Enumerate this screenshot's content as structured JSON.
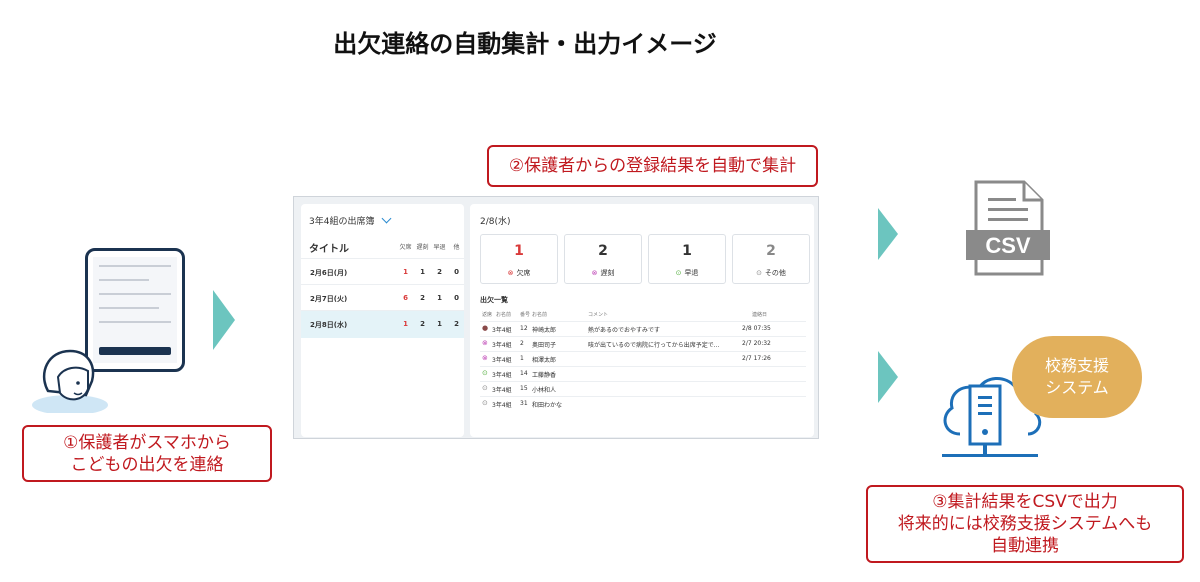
{
  "title": "出欠連絡の自動集計・出力イメージ",
  "step1": {
    "line1": "①保護者がスマホから",
    "line2": "こどもの出欠を連絡"
  },
  "step2": {
    "label": "②保護者からの登録結果を自動で集計"
  },
  "step3": {
    "line1": "③集計結果をCSVで出力",
    "line2": "将来的には校務支援システムへも",
    "line3": "自動連携"
  },
  "csv_icon": {
    "label": "CSV",
    "icon": "csv-file-icon"
  },
  "system": {
    "line1": "校務支援",
    "line2": "システム",
    "icon": "cloud-server-icon"
  },
  "colors": {
    "accent_red": "#c0191f",
    "arrow": "#6cc5bf",
    "bubble": "#e2b05c",
    "navy": "#1b3350",
    "blue": "#1d6fb8"
  },
  "app": {
    "left": {
      "header": "3年4組の出席簿",
      "column_title": "タイトル",
      "columns": [
        "欠席",
        "遅刻",
        "早退",
        "他"
      ],
      "rows": [
        {
          "date": "2月6日(月)",
          "values": [
            "1",
            "1",
            "2",
            "0"
          ]
        },
        {
          "date": "2月7日(火)",
          "values": [
            "6",
            "2",
            "1",
            "0"
          ]
        },
        {
          "date": "2月8日(水)",
          "values": [
            "1",
            "2",
            "1",
            "2"
          ]
        }
      ]
    },
    "right": {
      "date": "2/8(水)",
      "cards": [
        {
          "count": "1",
          "label": "欠席",
          "icon": "⊗"
        },
        {
          "count": "2",
          "label": "遅刻",
          "icon": "⊗"
        },
        {
          "count": "1",
          "label": "早退",
          "icon": "⊙"
        },
        {
          "count": "2",
          "label": "その他",
          "icon": "⊙"
        }
      ],
      "list_title": "出欠一覧",
      "list_headers": [
        "返席",
        "お名前",
        "番号",
        "お名前",
        "コメント",
        "連絡日"
      ],
      "list_rows": [
        {
          "icon": "●",
          "class": "3年4組",
          "number": "12",
          "name": "神崎太郎",
          "comment": "熱があるのでおやすみです",
          "timestamp": "2/8 07:35"
        },
        {
          "icon": "⊗",
          "class": "3年4組",
          "number": "2",
          "name": "奥田司子",
          "comment": "咳が出ているので病院に行ってから出席予定で...",
          "timestamp": "2/7 20:32"
        },
        {
          "icon": "⊗",
          "class": "3年4組",
          "number": "1",
          "name": "相澤太郎",
          "comment": "",
          "timestamp": "2/7 17:26"
        },
        {
          "icon": "⊙",
          "class": "3年4組",
          "number": "14",
          "name": "工藤静香",
          "comment": "",
          "timestamp": ""
        },
        {
          "icon": "⊙",
          "class": "3年4組",
          "number": "15",
          "name": "小林和人",
          "comment": "",
          "timestamp": ""
        },
        {
          "icon": "⊙",
          "class": "3年4組",
          "number": "31",
          "name": "和田わかな",
          "comment": "",
          "timestamp": ""
        }
      ]
    }
  }
}
